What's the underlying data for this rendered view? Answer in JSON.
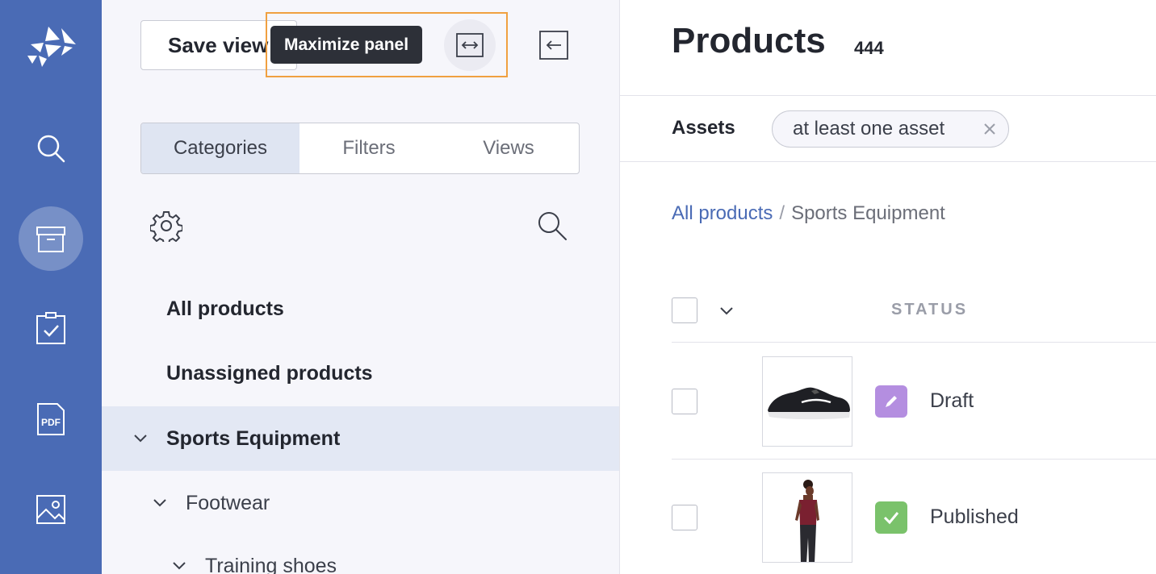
{
  "nav": {
    "items": [
      {
        "icon": "logo-icon"
      },
      {
        "icon": "search-icon"
      },
      {
        "icon": "products-box-icon",
        "active": true
      },
      {
        "icon": "tasks-clipboard-icon"
      },
      {
        "icon": "pdf-icon"
      },
      {
        "icon": "image-icon"
      }
    ]
  },
  "panel": {
    "save_view_label": "Save view",
    "tooltip": "Maximize panel",
    "tabs": [
      "Categories",
      "Filters",
      "Views"
    ],
    "active_tab": "Categories",
    "tree": [
      {
        "label": "All products"
      },
      {
        "label": "Unassigned products"
      },
      {
        "label": "Sports Equipment",
        "selected": true
      },
      {
        "label": "Footwear"
      },
      {
        "label": "Training shoes"
      }
    ]
  },
  "content": {
    "title": "Products",
    "count": "444",
    "filter": {
      "label": "Assets",
      "chip": "at least one asset"
    },
    "breadcrumb": {
      "root": "All products",
      "separator": "/",
      "current": "Sports Equipment"
    },
    "table": {
      "status_header": "STATUS",
      "rows": [
        {
          "status": "Draft",
          "status_color": "#b48ee0",
          "thumb": "sneaker"
        },
        {
          "status": "Published",
          "status_color": "#7ac26b",
          "thumb": "athlete"
        }
      ]
    }
  },
  "colors": {
    "nav_bg": "#4a6bb5",
    "accent": "#4a6bb5",
    "highlight": "#f0a040"
  }
}
